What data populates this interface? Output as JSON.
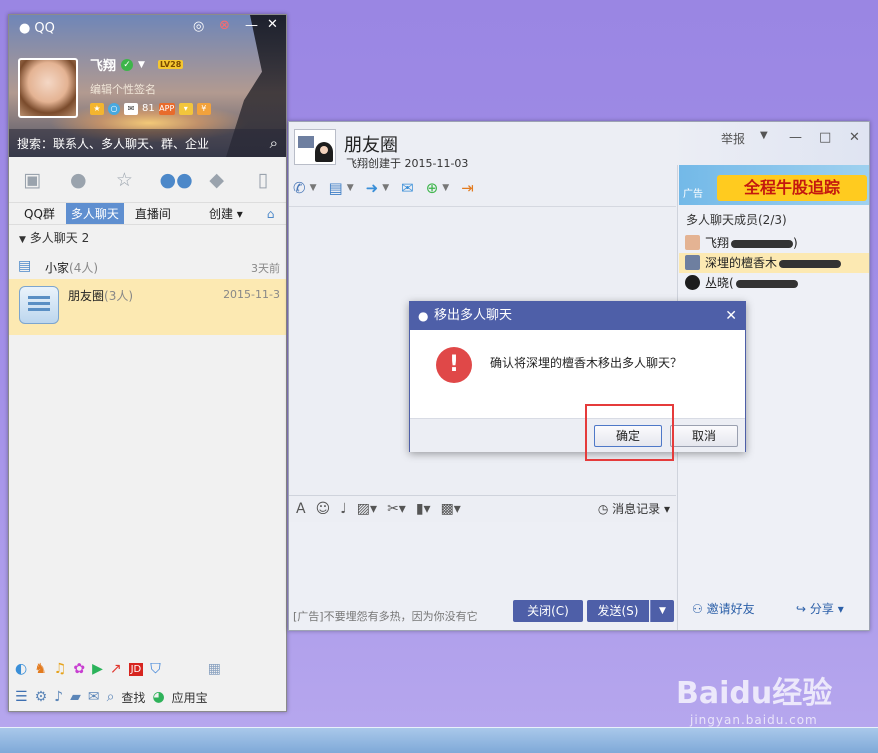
{
  "qq": {
    "logo": "QQ",
    "nickname": "飞翔",
    "level_badge": "LV28",
    "signature": "编辑个性签名",
    "mail_count": "81",
    "app_label": "APP",
    "search_placeholder": "搜索：联系人、多人聊天、群、企业",
    "subtabs": [
      "QQ群",
      "多人聊天",
      "直播间"
    ],
    "create_label": "创建",
    "group_header": "多人聊天",
    "group_count": "2",
    "chats": [
      {
        "name": "小家",
        "count": "(4人)",
        "time": "3天前"
      },
      {
        "name": "朋友圈",
        "count": "(3人)",
        "time": "2015-11-3"
      }
    ],
    "bottom": {
      "find": "查找",
      "appstore": "应用宝",
      "jd": "JD"
    }
  },
  "chat": {
    "title": "朋友圈",
    "subtitle": "飞翔创建于 2015-11-03",
    "report_label": "举报",
    "history_label": "消息记录",
    "ad_text": "[广告]不要埋怨有多热，因为你没有它",
    "close_button": "关闭(C)",
    "send_button": "发送(S)",
    "side": {
      "ad_tag": "广告",
      "ad_banner": "全程牛股追踪",
      "members_title": "多人聊天成员(2/3)",
      "members": [
        "飞翔",
        "深埋的檀香木",
        "丛晓"
      ],
      "invite_label": "邀请好友",
      "share_label": "分享"
    }
  },
  "dialog": {
    "title": "移出多人聊天",
    "message": "确认将深埋的檀香木移出多人聊天？",
    "confirm": "确定",
    "cancel": "取消"
  },
  "watermark": {
    "brand": "Baidu经验",
    "url": "jingyan.baidu.com"
  },
  "colors": {
    "accent": "#4e5fa8",
    "selected_row": "#fce9b2",
    "warning": "#e04848",
    "highlight_box": "#e53b3b",
    "desktop": "#a390e8"
  }
}
